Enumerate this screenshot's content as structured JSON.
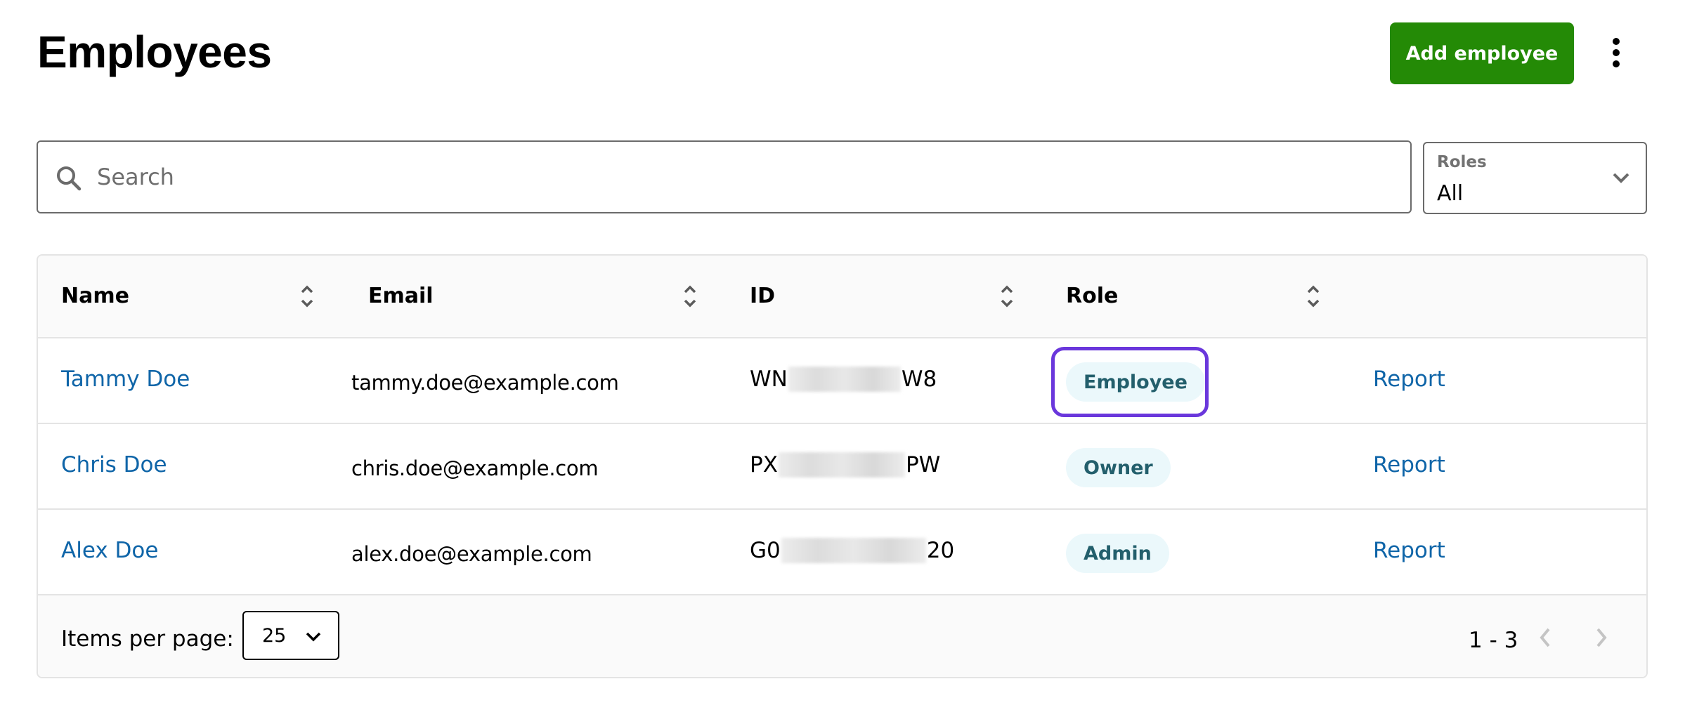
{
  "header": {
    "title": "Employees",
    "add_button_label": "Add employee",
    "more_menu_icon": "kebab-vertical-icon"
  },
  "filters": {
    "search": {
      "placeholder": "Search",
      "value": "",
      "icon": "search-icon"
    },
    "roles": {
      "label": "Roles",
      "selected": "All",
      "icon": "chevron-down-icon"
    }
  },
  "table": {
    "columns": [
      {
        "label": "Name",
        "sortable": true
      },
      {
        "label": "Email",
        "sortable": true
      },
      {
        "label": "ID",
        "sortable": true
      },
      {
        "label": "Role",
        "sortable": true
      }
    ],
    "rows": [
      {
        "name": "Tammy Doe",
        "email": "tammy.doe@example.com",
        "id_prefix": "WN",
        "id_suffix": "W8",
        "id_redacted": true,
        "role": "Employee",
        "action": "Report",
        "focused": true
      },
      {
        "name": "Chris Doe",
        "email": "chris.doe@example.com",
        "id_prefix": "PX",
        "id_suffix": "PW",
        "id_redacted": true,
        "role": "Owner",
        "action": "Report",
        "focused": false
      },
      {
        "name": "Alex Doe",
        "email": "alex.doe@example.com",
        "id_prefix": "G0",
        "id_suffix": "20",
        "id_redacted": true,
        "role": "Admin",
        "action": "Report",
        "focused": false
      }
    ]
  },
  "pagination": {
    "items_per_page_label": "Items per page:",
    "items_per_page": "25",
    "range": "1 - 3",
    "prev_enabled": false,
    "next_enabled": false
  },
  "colors": {
    "primary_button": "#248a06",
    "link": "#0f65a8",
    "badge_bg": "#ebf8fb",
    "badge_text": "#235f6c",
    "focus_ring": "#6a37dc",
    "disabled_icon": "#c4c4c4"
  }
}
